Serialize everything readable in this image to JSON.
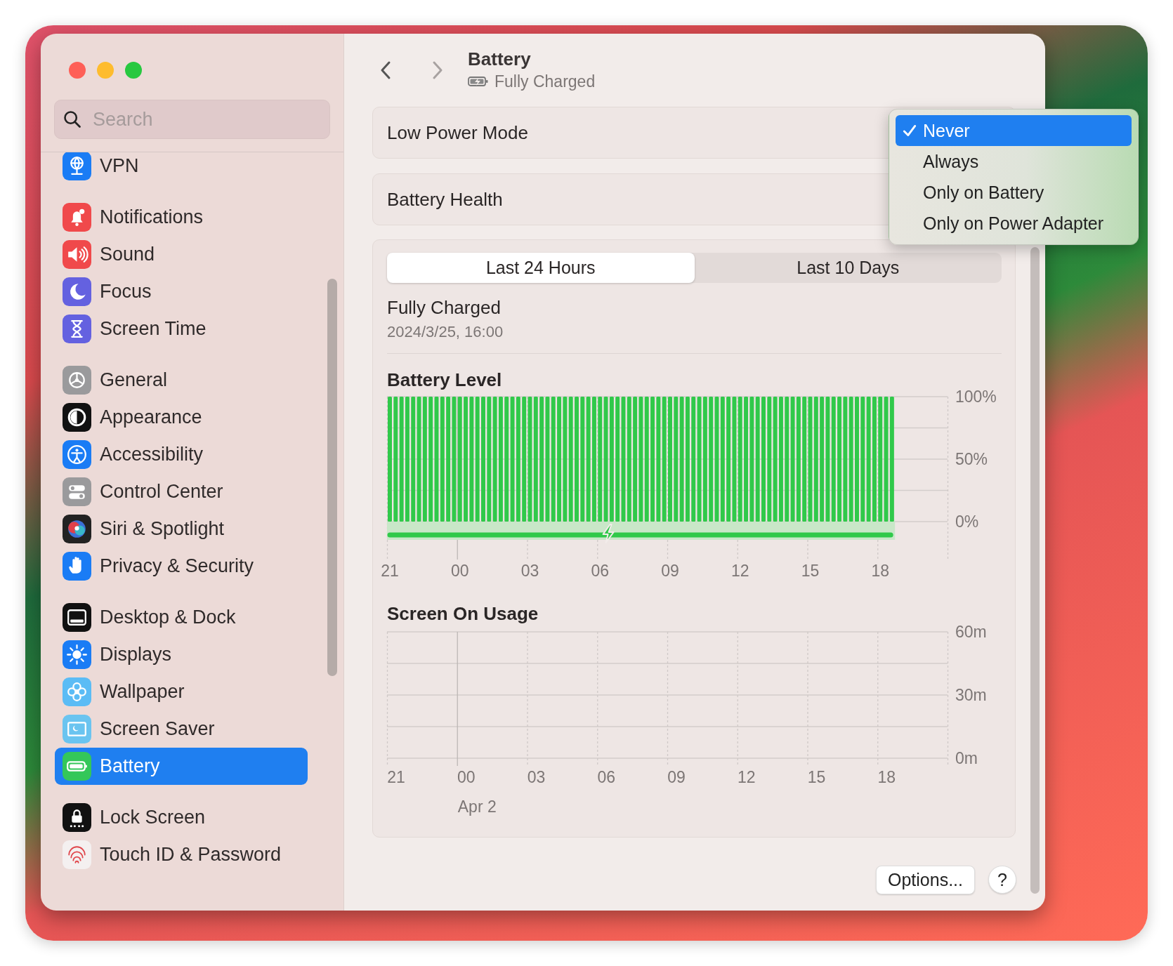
{
  "window": {
    "title": "Battery",
    "subtitle": "Fully Charged"
  },
  "navigation": {
    "back": {
      "disabled": false
    },
    "forward": {
      "disabled": true
    }
  },
  "sidebar": {
    "search": {
      "placeholder": "Search"
    },
    "groups": [
      {
        "items": [
          {
            "label": "VPN",
            "kind": "globe",
            "color": "#1a7cf5",
            "selected": false
          }
        ]
      },
      {
        "items": [
          {
            "label": "Notifications",
            "kind": "bell",
            "color": "#f0494b",
            "selected": false
          },
          {
            "label": "Sound",
            "kind": "speaker",
            "color": "#f0494b",
            "selected": false
          },
          {
            "label": "Focus",
            "kind": "moon",
            "color": "#6461e0",
            "selected": false
          },
          {
            "label": "Screen Time",
            "kind": "hourglass",
            "color": "#6461e0",
            "selected": false
          }
        ]
      },
      {
        "items": [
          {
            "label": "General",
            "kind": "gear",
            "color": "#9a9a9c",
            "selected": false
          },
          {
            "label": "Appearance",
            "kind": "contrast",
            "color": "#111111",
            "selected": false
          },
          {
            "label": "Accessibility",
            "kind": "person",
            "color": "#1a7cf5",
            "selected": false
          },
          {
            "label": "Control Center",
            "kind": "toggles",
            "color": "#9a9a9c",
            "selected": false
          },
          {
            "label": "Siri & Spotlight",
            "kind": "orb",
            "color": "#222222",
            "selected": false
          },
          {
            "label": "Privacy & Security",
            "kind": "hand",
            "color": "#1a7cf5",
            "selected": false
          }
        ]
      },
      {
        "items": [
          {
            "label": "Desktop & Dock",
            "kind": "window",
            "color": "#111111",
            "selected": false
          },
          {
            "label": "Displays",
            "kind": "sun",
            "color": "#1a7cf5",
            "selected": false
          },
          {
            "label": "Wallpaper",
            "kind": "flower",
            "color": "#5bbcf5",
            "selected": false
          },
          {
            "label": "Screen Saver",
            "kind": "screen",
            "color": "#6ac4f0",
            "selected": false
          },
          {
            "label": "Battery",
            "kind": "battery",
            "color": "#34c759",
            "selected": true
          }
        ]
      },
      {
        "items": [
          {
            "label": "Lock Screen",
            "kind": "lock",
            "color": "#111111",
            "selected": false
          },
          {
            "label": "Touch ID & Password",
            "kind": "fingerprint",
            "color": "#f4f0f0",
            "selected": false
          }
        ]
      }
    ]
  },
  "settings": [
    {
      "label": "Low Power Mode"
    },
    {
      "label": "Battery Health"
    }
  ],
  "menu": {
    "items": [
      {
        "label": "Never",
        "selected": true
      },
      {
        "label": "Always",
        "selected": false
      },
      {
        "label": "Only on Battery",
        "selected": false
      },
      {
        "label": "Only on Power Adapter",
        "selected": false
      }
    ]
  },
  "usage": {
    "tabs": [
      {
        "label": "Last 24 Hours",
        "selected": true
      },
      {
        "label": "Last 10 Days",
        "selected": false
      }
    ],
    "status": {
      "title": "Fully Charged",
      "time": "2024/3/25, 16:00"
    },
    "battery_level": {
      "chart_data": {
        "type": "bar",
        "title": "Battery Level",
        "ylim": [
          0,
          100
        ],
        "categories": [
          "21",
          null,
          null,
          null,
          null,
          null,
          null,
          null,
          null,
          null,
          null,
          null,
          "00",
          null,
          null,
          null,
          null,
          null,
          null,
          null,
          null,
          null,
          null,
          null,
          "03",
          null,
          null,
          null,
          null,
          null,
          null,
          null,
          null,
          null,
          null,
          null,
          "06",
          null,
          null,
          null,
          null,
          null,
          null,
          null,
          null,
          null,
          null,
          null,
          "09",
          null,
          null,
          null,
          null,
          null,
          null,
          null,
          null,
          null,
          null,
          null,
          "12",
          null,
          null,
          null,
          null,
          null,
          null,
          null,
          null,
          null,
          null,
          null,
          "15",
          null,
          null,
          null,
          null,
          null,
          null,
          null,
          null,
          null,
          null,
          null,
          "18",
          null,
          null,
          null,
          null,
          null,
          null,
          null,
          null,
          null,
          null,
          null
        ],
        "values": [
          100,
          100,
          100,
          100,
          100,
          100,
          100,
          100,
          100,
          100,
          100,
          100,
          100,
          100,
          100,
          100,
          100,
          100,
          100,
          100,
          100,
          100,
          100,
          100,
          100,
          100,
          100,
          100,
          100,
          100,
          100,
          100,
          100,
          100,
          100,
          100,
          100,
          100,
          100,
          100,
          100,
          100,
          100,
          100,
          100,
          100,
          100,
          100,
          100,
          100,
          100,
          100,
          100,
          100,
          100,
          100,
          100,
          100,
          100,
          100,
          100,
          100,
          100,
          100,
          100,
          100,
          100,
          100,
          100,
          100,
          100,
          100,
          100,
          100,
          100,
          100,
          100,
          100,
          100,
          100,
          100,
          100,
          100,
          100,
          100,
          100,
          100,
          null,
          null,
          null,
          null,
          null,
          null,
          null,
          null,
          null
        ],
        "yticks": [
          {
            "value": 0,
            "label": "0%"
          },
          {
            "value": 50,
            "label": "50%"
          },
          {
            "value": 100,
            "label": "100%"
          }
        ]
      }
    },
    "screen_on_usage": {
      "date_label": "Apr 2",
      "chart_data": {
        "type": "bar",
        "title": "Screen On Usage",
        "ylim": [
          0,
          60
        ],
        "categories": [
          "21",
          null,
          null,
          "00",
          null,
          null,
          "03",
          null,
          null,
          "06",
          null,
          null,
          "09",
          null,
          null,
          "12",
          null,
          null,
          "15",
          null,
          null,
          "18",
          null,
          null
        ],
        "values": [
          0,
          0,
          0,
          0,
          0,
          0,
          0,
          0,
          0,
          0,
          0,
          0,
          0,
          0,
          0,
          0,
          0,
          0,
          0,
          0,
          0,
          0,
          null,
          null
        ],
        "yticks": [
          {
            "value": 0,
            "label": "0m"
          },
          {
            "value": 30,
            "label": "30m"
          },
          {
            "value": 60,
            "label": "60m"
          }
        ]
      }
    }
  },
  "footer_buttons": [
    {
      "label": "Options...",
      "kind": "text"
    },
    {
      "label": "?",
      "kind": "help"
    }
  ]
}
